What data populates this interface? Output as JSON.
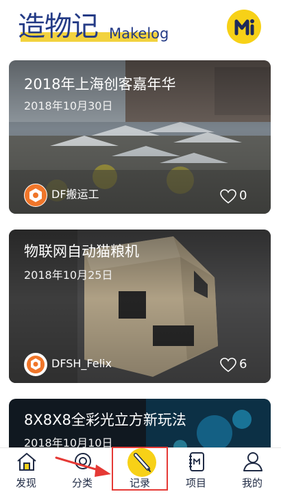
{
  "header": {
    "title_cn": "造物记",
    "title_en": "Makelog",
    "logo_icon": "makelog-logo-icon",
    "accent_color": "#f2d23e",
    "title_color": "#243b86"
  },
  "cards": [
    {
      "title": "2018年上海创客嘉年华",
      "date": "2018年10月30日",
      "author": "DF搬运工",
      "likes": "0"
    },
    {
      "title": "物联网自动猫粮机",
      "date": "2018年10月25日",
      "author": "DFSH_Felix",
      "likes": "6"
    },
    {
      "title": "8X8X8全彩光立方新玩法",
      "date": "2018年10月10日"
    }
  ],
  "tabbar": {
    "tabs": [
      {
        "label": "发现",
        "icon": "house-icon"
      },
      {
        "label": "分类",
        "icon": "category-icon"
      },
      {
        "label": "记录",
        "icon": "pen-icon",
        "active": true
      },
      {
        "label": "项目",
        "icon": "notebook-icon"
      },
      {
        "label": "我的",
        "icon": "user-icon"
      }
    ],
    "active_color": "#f7d117",
    "annotation_color": "#e53935"
  }
}
